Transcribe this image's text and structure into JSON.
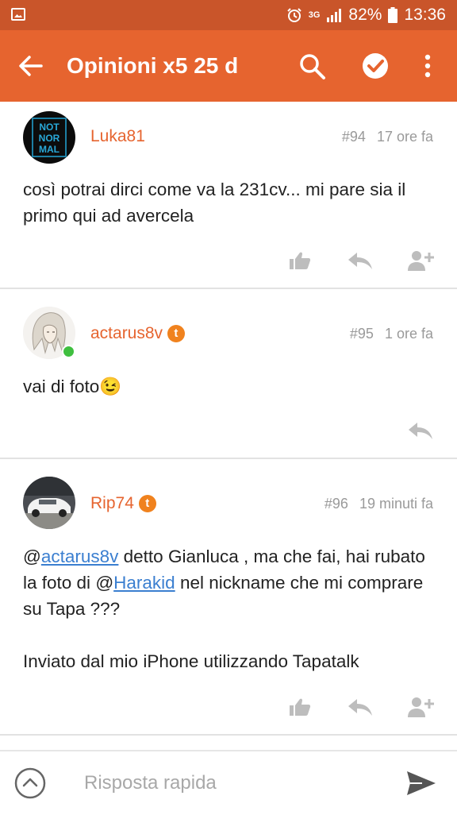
{
  "status_bar": {
    "battery": "82%",
    "time": "13:36",
    "network": "3G"
  },
  "app_bar": {
    "title": "Opinioni x5 25 d",
    "icons": [
      "back-arrow-icon",
      "search-icon",
      "check-circle-icon",
      "more-vert-icon"
    ]
  },
  "posts": [
    {
      "username": "Luka81",
      "number": "#94",
      "time": "17 ore fa",
      "avatar_text": [
        "NOT",
        "NOR",
        "MAL"
      ],
      "body": "così potrai dirci come va la 231cv... mi pare sia il primo qui ad avercela",
      "actions": [
        "like-icon",
        "reply-icon",
        "follow-icon"
      ]
    },
    {
      "username": "actarus8v",
      "number": "#95",
      "time": "1 ore fa",
      "badge": "t",
      "online": true,
      "body": "vai di foto",
      "emoji": "😉",
      "actions": [
        "reply-icon"
      ]
    },
    {
      "username": "Rip74",
      "number": "#96",
      "time": "19 minuti fa",
      "badge": "t",
      "body_parts": {
        "at1": "@",
        "mention1": "actarus8v",
        "text1": " detto Gianluca , ma che fai, hai rubato la foto di ",
        "at2": "@",
        "mention2": "Harakid",
        "text2": " nel nickname che mi comprare su Tapa ???",
        "signature": "Inviato dal mio iPhone utilizzando Tapatalk"
      },
      "actions": [
        "like-icon",
        "reply-icon",
        "follow-icon"
      ]
    }
  ],
  "composer": {
    "placeholder": "Risposta rapida"
  },
  "colors": {
    "accent": "#e6642f",
    "status_bar": "#c9552a",
    "username": "#e6642f",
    "link": "#3b7fd0",
    "meta": "#9a9a9a",
    "icon": "#bdbdbd"
  }
}
